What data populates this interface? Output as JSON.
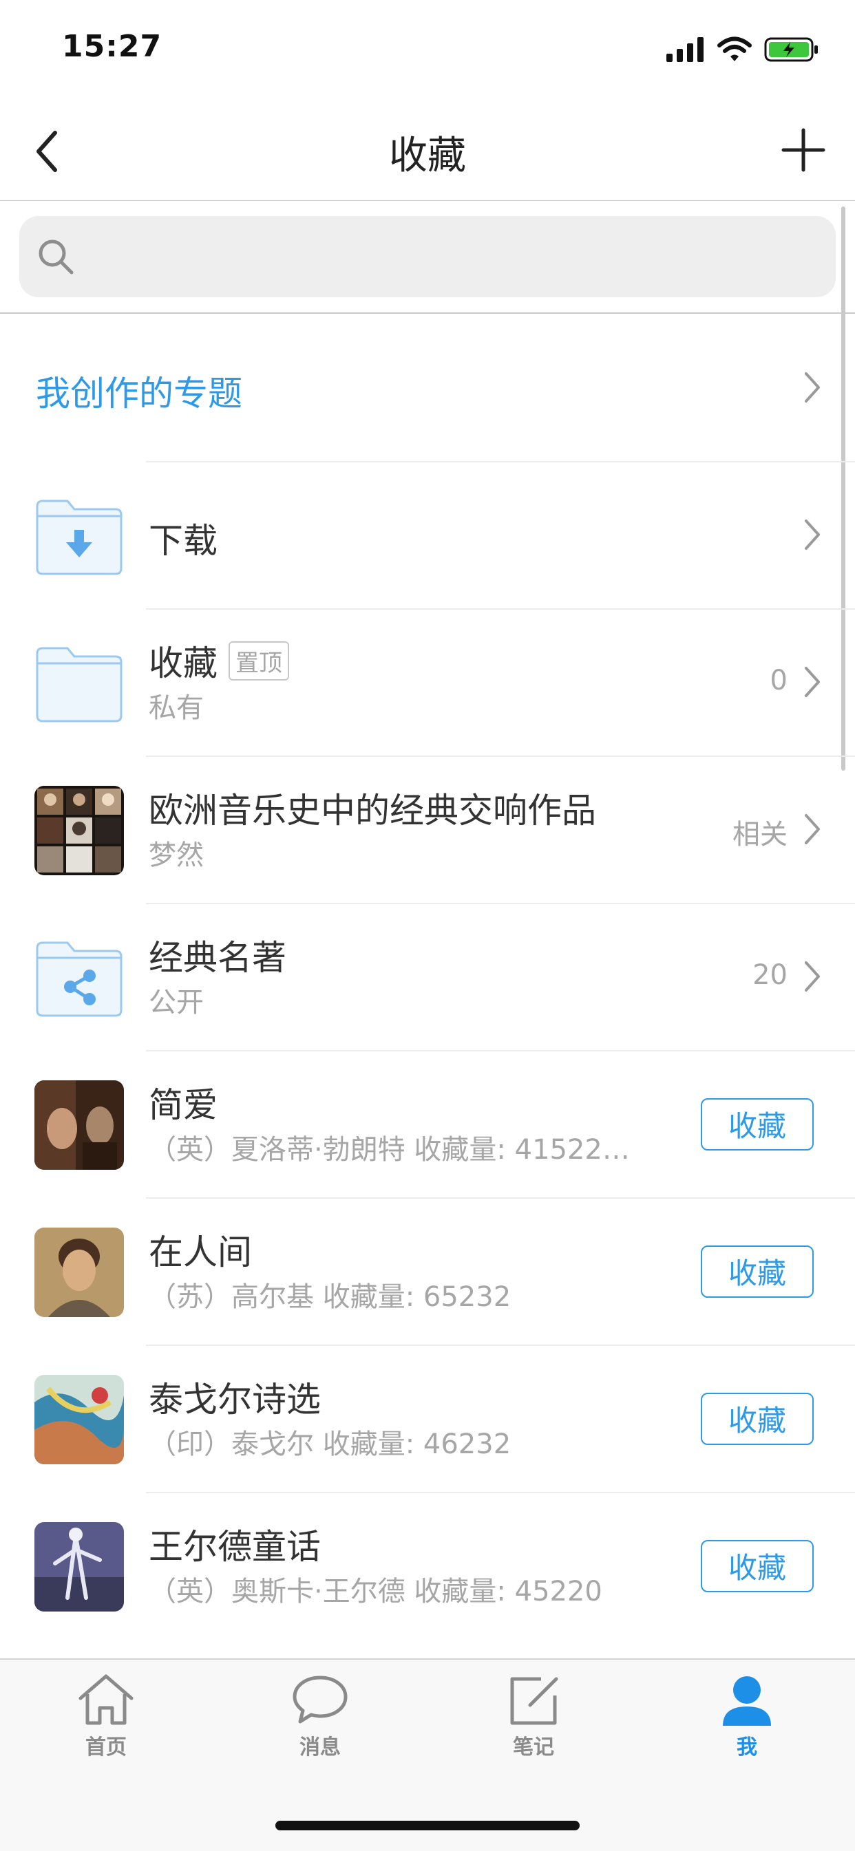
{
  "status_bar": {
    "time": "15:27"
  },
  "nav": {
    "title": "收藏"
  },
  "search": {
    "placeholder": "",
    "value": ""
  },
  "section": {
    "title": "我创作的专题"
  },
  "items": [
    {
      "type": "folder-download",
      "title": "下载",
      "subtitle": "",
      "meta": ""
    },
    {
      "type": "folder",
      "title": "收藏",
      "badge": "置顶",
      "subtitle": "私有",
      "meta": "0"
    },
    {
      "type": "image",
      "title": "欧洲音乐史中的经典交响作品",
      "subtitle": "梦然",
      "meta": "相关"
    },
    {
      "type": "folder-share",
      "title": "经典名著",
      "subtitle": "公开",
      "meta": "20"
    },
    {
      "type": "book",
      "title": "简爱",
      "subtitle": "（英）夏洛蒂·勃朗特  收藏量: 41522…",
      "action": "收藏"
    },
    {
      "type": "book",
      "title": "在人间",
      "subtitle": "（苏）高尔基  收藏量: 65232",
      "action": "收藏"
    },
    {
      "type": "book",
      "title": "泰戈尔诗选",
      "subtitle": "（印）泰戈尔  收藏量: 46232",
      "action": "收藏"
    },
    {
      "type": "book",
      "title": "王尔德童话",
      "subtitle": "（英）奥斯卡·王尔德  收藏量: 45220",
      "action": "收藏"
    }
  ],
  "tabs": [
    {
      "label": "首页",
      "icon": "home-icon",
      "active": false
    },
    {
      "label": "消息",
      "icon": "message-icon",
      "active": false
    },
    {
      "label": "笔记",
      "icon": "note-icon",
      "active": false
    },
    {
      "label": "我",
      "icon": "user-icon",
      "active": true
    }
  ],
  "colors": {
    "accent": "#2e9ae6",
    "folder": "#9cc9f0",
    "folder_fill": "#eef6fd"
  }
}
